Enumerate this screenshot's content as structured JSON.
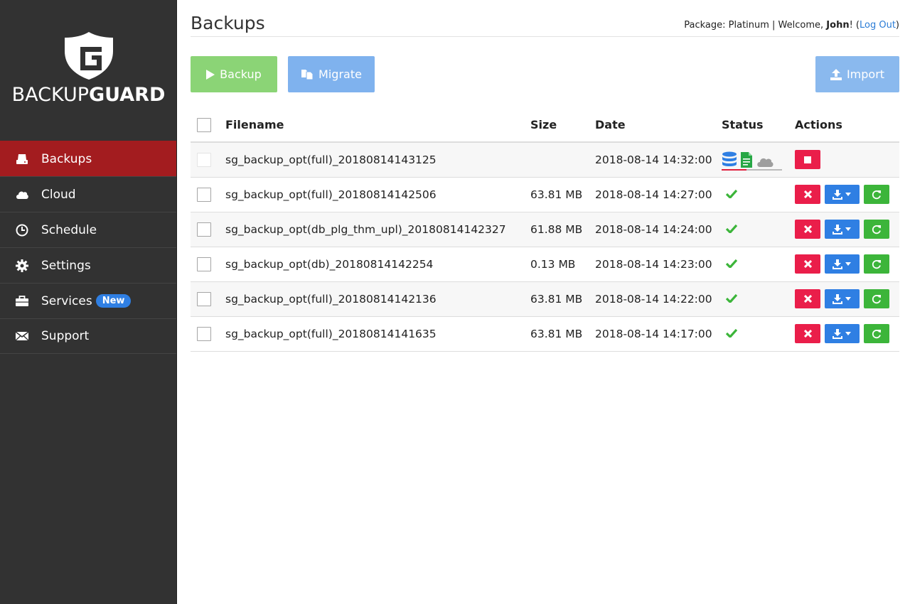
{
  "brand": {
    "logo_thin": "BACKUP",
    "logo_bold": "GUARD"
  },
  "sidebar": {
    "items": [
      {
        "label": "Backups",
        "icon": "hard-drive-icon",
        "active": true
      },
      {
        "label": "Cloud",
        "icon": "cloud-icon"
      },
      {
        "label": "Schedule",
        "icon": "clock-icon"
      },
      {
        "label": "Settings",
        "icon": "gear-icon"
      },
      {
        "label": "Services",
        "icon": "briefcase-icon",
        "badge": "New"
      },
      {
        "label": "Support",
        "icon": "envelope-icon"
      }
    ]
  },
  "header": {
    "title": "Backups",
    "package_prefix": "Package: Platinum | Welcome, ",
    "user_name": "John",
    "user_suffix": "! (",
    "logout_label": "Log Out",
    "close_paren": ")"
  },
  "toolbar": {
    "backup_label": "Backup",
    "migrate_label": "Migrate",
    "import_label": "Import"
  },
  "table": {
    "columns": {
      "filename": "Filename",
      "size": "Size",
      "date": "Date",
      "status": "Status",
      "actions": "Actions"
    },
    "rows": [
      {
        "filename": "sg_backup_opt(full)_20180814143125",
        "size": "",
        "date": "2018-08-14 14:32:00",
        "status": "in-progress"
      },
      {
        "filename": "sg_backup_opt(full)_20180814142506",
        "size": "63.81 MB",
        "date": "2018-08-14 14:27:00",
        "status": "done"
      },
      {
        "filename": "sg_backup_opt(db_plg_thm_upl)_20180814142327",
        "size": "61.88 MB",
        "date": "2018-08-14 14:24:00",
        "status": "done"
      },
      {
        "filename": "sg_backup_opt(db)_20180814142254",
        "size": "0.13 MB",
        "date": "2018-08-14 14:23:00",
        "status": "done"
      },
      {
        "filename": "sg_backup_opt(full)_20180814142136",
        "size": "63.81 MB",
        "date": "2018-08-14 14:22:00",
        "status": "done"
      },
      {
        "filename": "sg_backup_opt(full)_20180814141635",
        "size": "63.81 MB",
        "date": "2018-08-14 14:17:00",
        "status": "done"
      }
    ]
  },
  "colors": {
    "sidebar_bg": "#323232",
    "active_nav": "#a31c1f",
    "backup_btn": "#8bd476",
    "migrate_btn": "#7fb2ee",
    "import_btn": "#8ab9ee",
    "delete": "#ea1e4a",
    "download": "#2f7fe3",
    "restore": "#3cb53a",
    "check": "#3cb53a"
  }
}
